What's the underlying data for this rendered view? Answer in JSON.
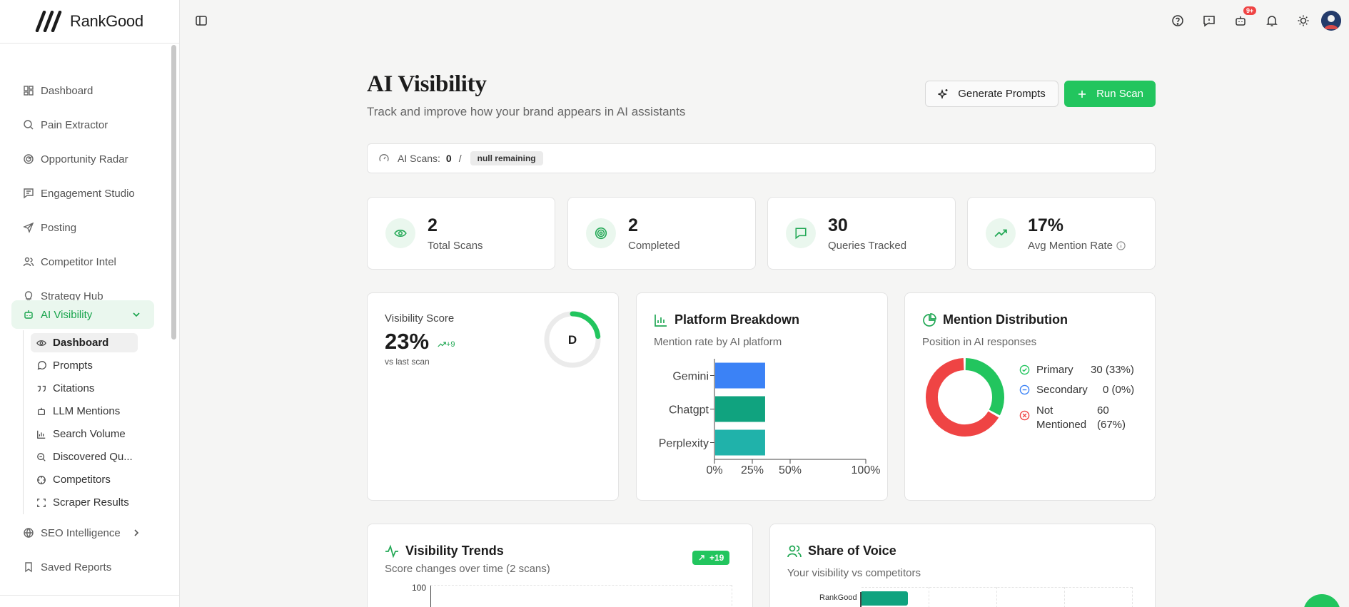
{
  "brand": {
    "name": "RankGood"
  },
  "sidebar": {
    "items": [
      {
        "label": "Dashboard",
        "icon": "grid-icon"
      },
      {
        "label": "Pain Extractor",
        "icon": "search-icon"
      },
      {
        "label": "Opportunity Radar",
        "icon": "radar-icon"
      },
      {
        "label": "Engagement Studio",
        "icon": "message-icon"
      },
      {
        "label": "Posting",
        "icon": "send-icon"
      },
      {
        "label": "Competitor Intel",
        "icon": "users-icon"
      },
      {
        "label": "Strategy Hub",
        "icon": "lightbulb-icon"
      },
      {
        "label": "AI Visibility",
        "icon": "bot-icon"
      }
    ],
    "sub_items": [
      {
        "label": "Dashboard",
        "icon": "eye-icon"
      },
      {
        "label": "Prompts",
        "icon": "chat-icon"
      },
      {
        "label": "Citations",
        "icon": "quote-icon"
      },
      {
        "label": "LLM Mentions",
        "icon": "bot-icon"
      },
      {
        "label": "Search Volume",
        "icon": "bar-chart-icon"
      },
      {
        "label": "Discovered Qu...",
        "icon": "search-icon"
      },
      {
        "label": "Competitors",
        "icon": "crosshair-icon"
      },
      {
        "label": "Scraper Results",
        "icon": "scan-icon"
      }
    ],
    "after_items": [
      {
        "label": "SEO Intelligence",
        "icon": "globe-icon"
      },
      {
        "label": "Saved Reports",
        "icon": "bookmark-icon"
      }
    ]
  },
  "topbar": {
    "notification_badge": "9+"
  },
  "header": {
    "title": "AI Visibility",
    "subtitle": "Track and improve how your brand appears in AI assistants",
    "generate_label": "Generate Prompts",
    "run_label": "Run Scan"
  },
  "scans": {
    "label": "AI Scans:",
    "value": "0",
    "separator": "/",
    "remaining": "null remaining"
  },
  "stats": [
    {
      "value": "2",
      "label": "Total Scans",
      "icon": "eye-icon"
    },
    {
      "value": "2",
      "label": "Completed",
      "icon": "target-icon"
    },
    {
      "value": "30",
      "label": "Queries Tracked",
      "icon": "message-square-icon"
    },
    {
      "value": "17%",
      "label": "Avg Mention Rate",
      "icon": "trending-up-icon"
    }
  ],
  "visibility": {
    "label": "Visibility Score",
    "score": "23%",
    "delta": "+9",
    "compare": "vs last scan",
    "grade": "D",
    "score_fraction": 0.23
  },
  "platform": {
    "title": "Platform Breakdown",
    "subtitle": "Mention rate by AI platform"
  },
  "mention": {
    "title": "Mention Distribution",
    "subtitle": "Position in AI responses",
    "rows": [
      {
        "label": "Primary",
        "value": "30 (33%)",
        "color": "#22c55e"
      },
      {
        "label": "Secondary",
        "value": "0 (0%)",
        "color": "#3b82f6"
      },
      {
        "label_line1": "Not",
        "label_line2": "Mentioned",
        "value_line1": "60",
        "value_line2": "(67%)",
        "color": "#ef4444"
      }
    ]
  },
  "trends": {
    "title": "Visibility Trends",
    "subtitle": "Score changes over time (2 scans)",
    "badge": "+19",
    "y_top": "100"
  },
  "share": {
    "title": "Share of Voice",
    "subtitle": "Your visibility vs competitors",
    "first_label": "RankGood"
  },
  "chart_data": [
    {
      "type": "bar",
      "orientation": "horizontal",
      "categories": [
        "Gemini",
        "Chatgpt",
        "Perplexity"
      ],
      "values": [
        33,
        33,
        33
      ],
      "colors": [
        "#3b82f6",
        "#10a37f",
        "#20b2aa"
      ],
      "xlim": [
        0,
        100
      ],
      "xticks": [
        "0%",
        "25%",
        "50%",
        "100%"
      ]
    },
    {
      "type": "pie",
      "categories": [
        "Primary",
        "Secondary",
        "Not Mentioned"
      ],
      "values": [
        30,
        0,
        60
      ],
      "colors": [
        "#22c55e",
        "#3b82f6",
        "#ef4444"
      ]
    }
  ]
}
